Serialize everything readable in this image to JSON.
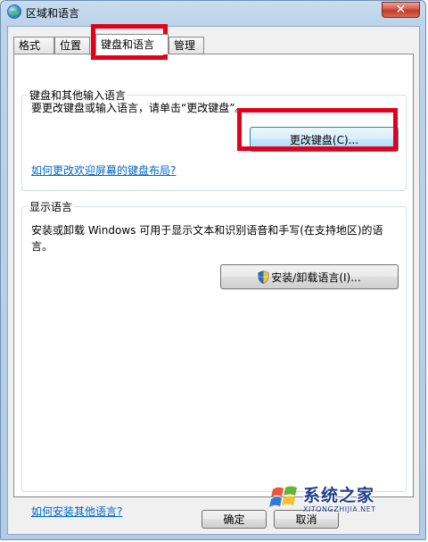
{
  "window": {
    "title": "区域和语言",
    "close_label": "✕"
  },
  "tabs": [
    {
      "label": "格式",
      "active": false
    },
    {
      "label": "位置",
      "active": false
    },
    {
      "label": "键盘和语言",
      "active": true
    },
    {
      "label": "管理",
      "active": false
    }
  ],
  "keyboards_group": {
    "title": "键盘和其他输入语言",
    "description": "要更改键盘或输入语言，请单击“更改键盘”。",
    "change_button": "更改键盘(C)...",
    "welcome_link": "如何更改欢迎屏幕的键盘布局?"
  },
  "display_language_group": {
    "title": "显示语言",
    "description_line1": "安装或卸载 Windows 可用于显示文本和识别语音和手写(在支持地区)的语",
    "description_line2": "言。",
    "install_button": "安装/卸载语言(I)..."
  },
  "install_link": "如何安装其他语言?",
  "footer": {
    "ok_button": "确定",
    "cancel_button": "取消"
  },
  "watermark": {
    "name": "系统之家",
    "url": "XITONGZHIJIA.NET"
  },
  "colors": {
    "highlight": "#e3001b",
    "link": "#0066cc",
    "titlebar": "#bcd3ea"
  }
}
